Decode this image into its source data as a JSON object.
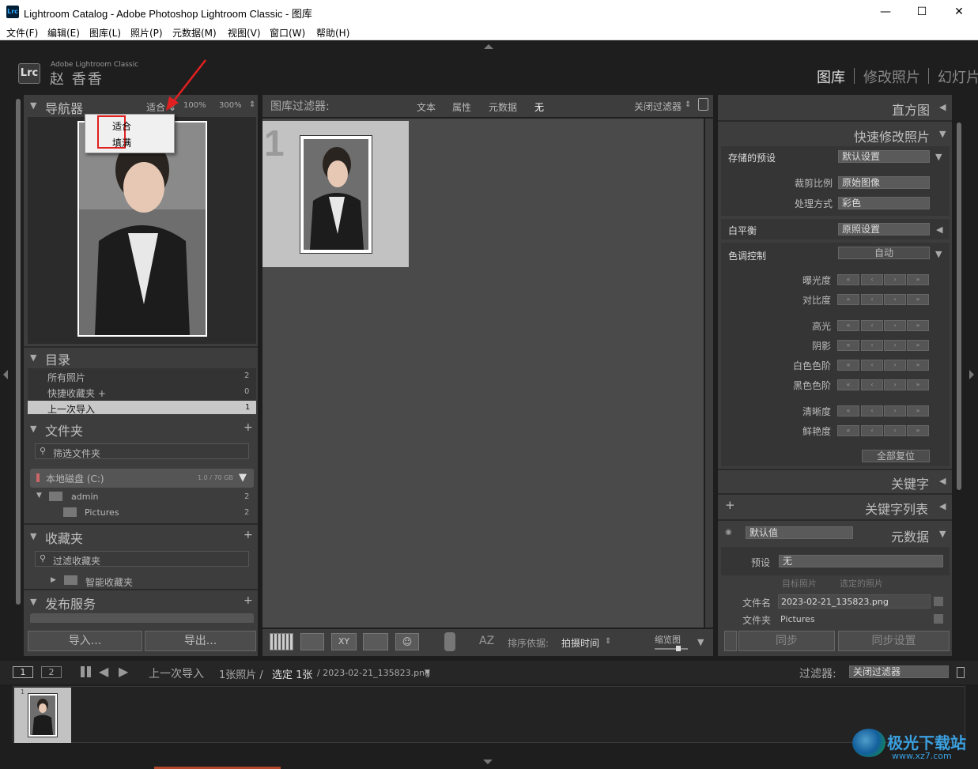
{
  "window": {
    "app_icon": "Lrc",
    "title": "Lightroom Catalog - Adobe Photoshop Lightroom Classic - 图库",
    "minimize": "—",
    "maximize": "☐",
    "close": "✕"
  },
  "menu": [
    "文件(F)",
    "编辑(E)",
    "图库(L)",
    "照片(P)",
    "元数据(M)",
    "视图(V)",
    "窗口(W)",
    "帮助(H)"
  ],
  "identity": {
    "logo": "Lrc",
    "product": "Adobe Lightroom Classic",
    "user": "赵 香香"
  },
  "modules": [
    "图库",
    "修改照片",
    "幻灯片"
  ],
  "navigator": {
    "title": "导航器",
    "zoom_options": [
      "适合",
      "100%",
      "300%"
    ],
    "popup_items": [
      "适合",
      "填满"
    ]
  },
  "catalog": {
    "title": "目录",
    "items": [
      {
        "label": "所有照片",
        "count": "2"
      },
      {
        "label": "快捷收藏夹 +",
        "count": "0"
      },
      {
        "label": "上一次导入",
        "count": "1"
      }
    ]
  },
  "folders": {
    "title": "文件夹",
    "filter_placeholder": "筛选文件夹",
    "disk": "本地磁盘 (C:)",
    "disk_usage": "1.0 / 70 GB",
    "items": [
      {
        "label": "admin",
        "count": "2"
      },
      {
        "label": "Pictures",
        "count": "2"
      }
    ]
  },
  "collections": {
    "title": "收藏夹",
    "filter_placeholder": "过滤收藏夹",
    "smart": "智能收藏夹"
  },
  "publish": {
    "title": "发布服务"
  },
  "import_button": "导入...",
  "export_button": "导出...",
  "library_filter": {
    "label": "图库过滤器:",
    "options": [
      "文本",
      "属性",
      "元数据",
      "无"
    ],
    "preset": "关闭过滤器"
  },
  "grid": {
    "cell_index": "1"
  },
  "toolbar": {
    "sort_label": "排序依据:",
    "sort_value": "拍摄时间",
    "thumb_label": "缩览图"
  },
  "right": {
    "histogram": "直方图",
    "quick_develop": "快速修改照片",
    "saved_preset_label": "存储的预设",
    "saved_preset_value": "默认设置",
    "crop_label": "裁剪比例",
    "crop_value": "原始图像",
    "treatment_label": "处理方式",
    "treatment_value": "彩色",
    "wb_label": "白平衡",
    "wb_value": "原照设置",
    "tone_label": "色调控制",
    "tone_auto": "自动",
    "sliders_a": [
      "曝光度",
      "对比度"
    ],
    "sliders_b": [
      "高光",
      "阴影",
      "白色色阶",
      "黑色色阶"
    ],
    "sliders_c": [
      "清晰度",
      "鲜艳度"
    ],
    "reset_all": "全部复位",
    "keywording": "关键字",
    "keyword_list": "关键字列表",
    "metadata": "元数据",
    "metadata_preset": "默认值",
    "preset_label": "预设",
    "preset_value": "无",
    "target_photo": "目标照片",
    "selected_photos": "选定的照片",
    "filename_label": "文件名",
    "filename_value": "2023-02-21_135823.png",
    "folder_label": "文件夹",
    "folder_value": "Pictures",
    "sync": "同步",
    "sync_settings": "同步设置"
  },
  "filmstrip": {
    "source": "上一次导入",
    "count_text": "1张照片 /",
    "selected_text": "选定 1张",
    "file": "/ 2023-02-21_135823.png",
    "filter_label": "过滤器:",
    "filter_value": "关闭过滤器",
    "page1": "1",
    "page2": "2",
    "thumb_index": "1"
  },
  "watermark": {
    "cn": "极光下载站",
    "url": "www.xz7.com"
  },
  "colors": {
    "highlight_box": "#e02020",
    "arrow": "#e02020",
    "panel": "#3d3d3d"
  }
}
